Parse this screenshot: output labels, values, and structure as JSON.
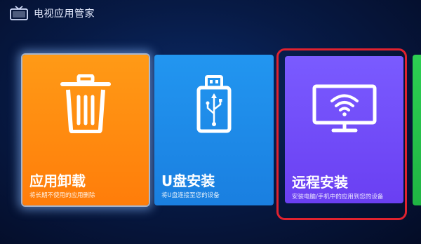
{
  "header": {
    "app_title": "电视应用管家",
    "icon": "tv-manager-icon"
  },
  "tiles": [
    {
      "title": "应用卸载",
      "description": "将长期不使用的应用删除",
      "icon": "trash-icon",
      "color": "#ff8c0f",
      "focused": true
    },
    {
      "title": "U盘安装",
      "description": "将U盘连接至您的设备",
      "icon": "usb-drive-icon",
      "color": "#1e8bea"
    },
    {
      "title": "远程安装",
      "description": "安装电脑/手机中的应用到您的设备",
      "icon": "wifi-monitor-icon",
      "color": "#734df8",
      "highlighted": true
    },
    {
      "title": "",
      "icon": "",
      "color": "#22c24b",
      "partially_visible": true
    }
  ],
  "highlight_color": "#e0222f"
}
